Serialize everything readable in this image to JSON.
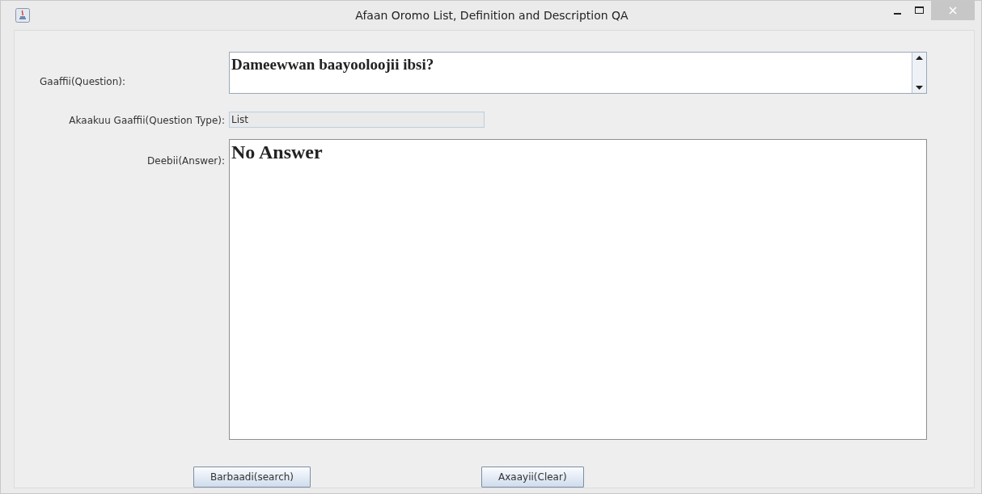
{
  "window": {
    "title": "Afaan Oromo List, Definition and Description QA"
  },
  "form": {
    "question_label": "Gaaffii(Question):",
    "question_value": "Dameewwan baayooloojii ibsi?",
    "type_label": "Akaakuu Gaaffii(Question Type):",
    "type_value": "List",
    "answer_label": "Deebii(Answer):",
    "answer_value": "No Answer"
  },
  "buttons": [
    "Barbaadi(search)",
    "Axaayii(Clear)"
  ]
}
